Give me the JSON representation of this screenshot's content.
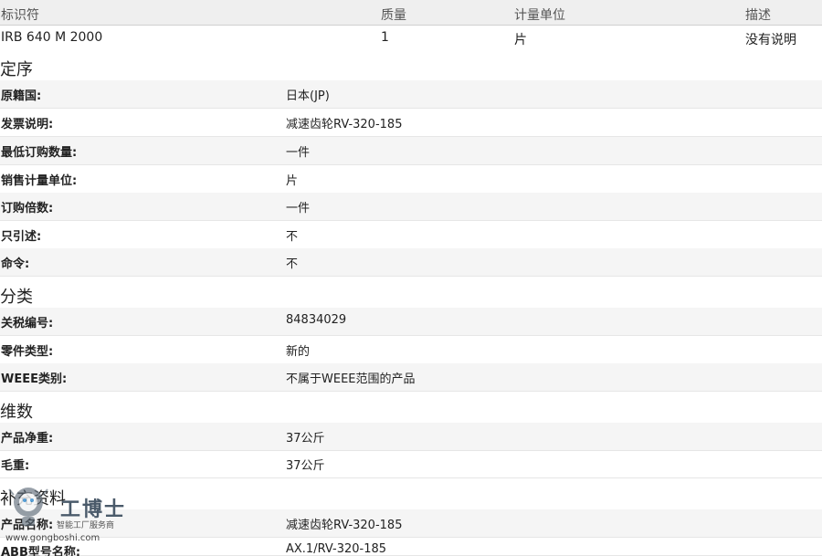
{
  "table_header": {
    "identifier": "标识符",
    "quantity": "质量",
    "unit": "计量单位",
    "description": "描述"
  },
  "identifier_row": {
    "identifier": "IRB 640 M 2000",
    "quantity": "1",
    "unit": "片",
    "description": "没有说明"
  },
  "sections": {
    "ordering": {
      "title": "定序",
      "rows": [
        {
          "label": "原籍国:",
          "value": "日本(JP)"
        },
        {
          "label": "发票说明:",
          "value": "减速齿轮RV-320-185"
        },
        {
          "label": "最低订购数量:",
          "value": "一件"
        },
        {
          "label": "销售计量单位:",
          "value": "片"
        },
        {
          "label": "订购倍数:",
          "value": "一件"
        },
        {
          "label": "只引述:",
          "value": "不"
        },
        {
          "label": "命令:",
          "value": "不"
        }
      ]
    },
    "classification": {
      "title": "分类",
      "rows": [
        {
          "label": "关税编号:",
          "value": "84834029"
        },
        {
          "label": "零件类型:",
          "value": "新的"
        },
        {
          "label": "WEEE类别:",
          "value": "不属于WEEE范围的产品"
        }
      ]
    },
    "dimensions": {
      "title": "维数",
      "rows": [
        {
          "label": "产品净重:",
          "value": "37公斤"
        },
        {
          "label": "毛重:",
          "value": "37公斤"
        }
      ]
    },
    "additional": {
      "title": "补充资料",
      "rows": [
        {
          "label": "产品名称:",
          "value": "减速齿轮RV-320-185"
        },
        {
          "label": "ABB型号名称:",
          "value": "AX.1/RV-320-185"
        }
      ]
    }
  },
  "watermark": {
    "name": "工博士",
    "tagline": "智能工厂服务商",
    "url": "www.gongboshi.com"
  }
}
